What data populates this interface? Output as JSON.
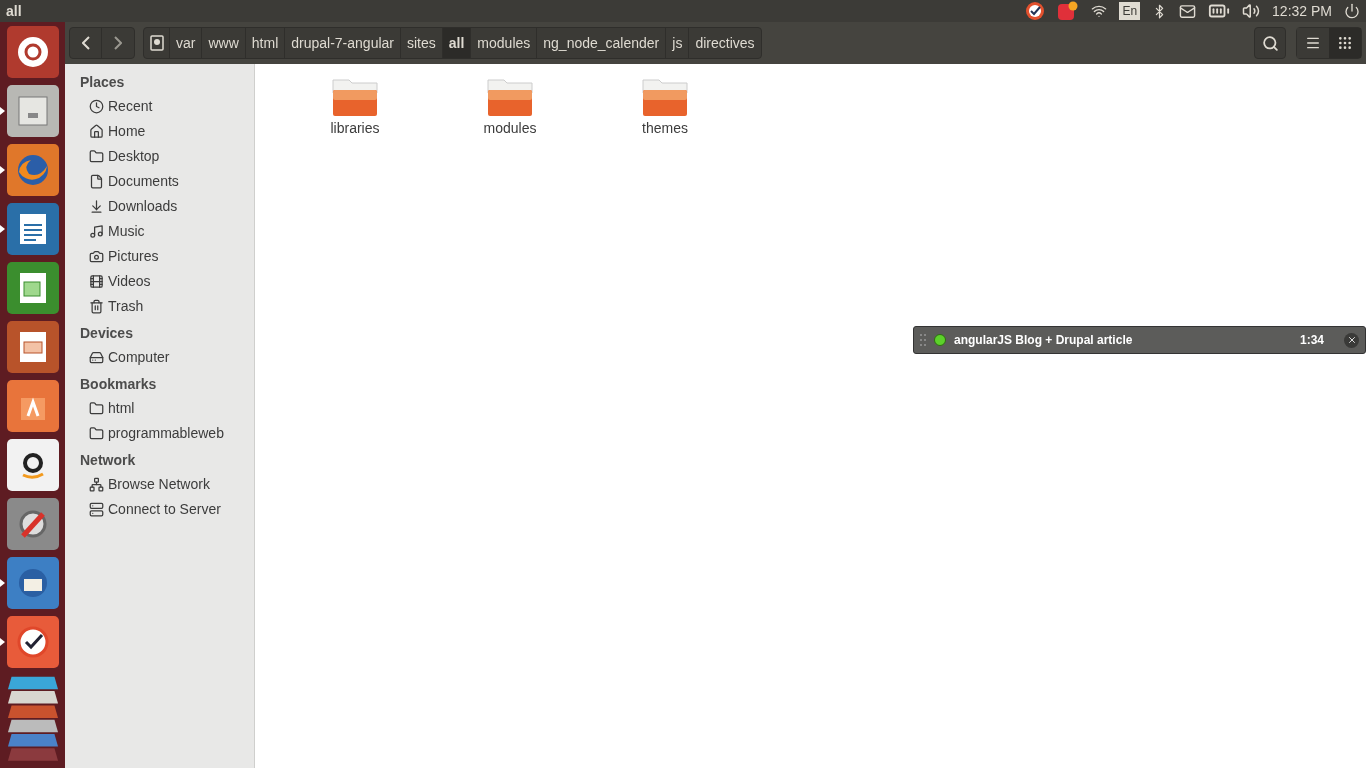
{
  "top_panel": {
    "title": "all",
    "keyboard_layout": "En",
    "clock": "12:32 PM"
  },
  "launcher": [
    {
      "kind": "ubuntu",
      "running": false
    },
    {
      "kind": "files",
      "running": true
    },
    {
      "kind": "firefox",
      "running": true
    },
    {
      "kind": "writer",
      "running": true
    },
    {
      "kind": "calc",
      "running": false
    },
    {
      "kind": "impress",
      "running": false
    },
    {
      "kind": "software",
      "running": false
    },
    {
      "kind": "amazon",
      "running": false
    },
    {
      "kind": "settings",
      "running": false
    },
    {
      "kind": "mail",
      "running": true
    },
    {
      "kind": "tasks",
      "running": true
    }
  ],
  "toolbar": {
    "path": [
      {
        "label": "var",
        "selected": false
      },
      {
        "label": "www",
        "selected": false
      },
      {
        "label": "html",
        "selected": false
      },
      {
        "label": "drupal-7-angular",
        "selected": false
      },
      {
        "label": "sites",
        "selected": false
      },
      {
        "label": "all",
        "selected": true
      },
      {
        "label": "modules",
        "selected": false
      },
      {
        "label": "ng_node_calender",
        "selected": false
      },
      {
        "label": "js",
        "selected": false
      },
      {
        "label": "directives",
        "selected": false
      }
    ],
    "views": [
      {
        "kind": "list",
        "selected": false
      },
      {
        "kind": "grid",
        "selected": true
      }
    ]
  },
  "sidebar": [
    {
      "heading": "Places",
      "items": [
        {
          "label": "Recent",
          "kind": "recent"
        },
        {
          "label": "Home",
          "kind": "home"
        },
        {
          "label": "Desktop",
          "kind": "folder"
        },
        {
          "label": "Documents",
          "kind": "document"
        },
        {
          "label": "Downloads",
          "kind": "download"
        },
        {
          "label": "Music",
          "kind": "music"
        },
        {
          "label": "Pictures",
          "kind": "camera"
        },
        {
          "label": "Videos",
          "kind": "film"
        },
        {
          "label": "Trash",
          "kind": "trash"
        }
      ]
    },
    {
      "heading": "Devices",
      "items": [
        {
          "label": "Computer",
          "kind": "drive"
        }
      ]
    },
    {
      "heading": "Bookmarks",
      "items": [
        {
          "label": "html",
          "kind": "folder"
        },
        {
          "label": "programmableweb",
          "kind": "folder"
        }
      ]
    },
    {
      "heading": "Network",
      "items": [
        {
          "label": "Browse Network",
          "kind": "network"
        },
        {
          "label": "Connect to Server",
          "kind": "server"
        }
      ]
    }
  ],
  "files": [
    {
      "name": "libraries"
    },
    {
      "name": "modules"
    },
    {
      "name": "themes"
    }
  ],
  "timer_bar": {
    "title": "angularJS Blog + Drupal article",
    "time": "1:34"
  }
}
